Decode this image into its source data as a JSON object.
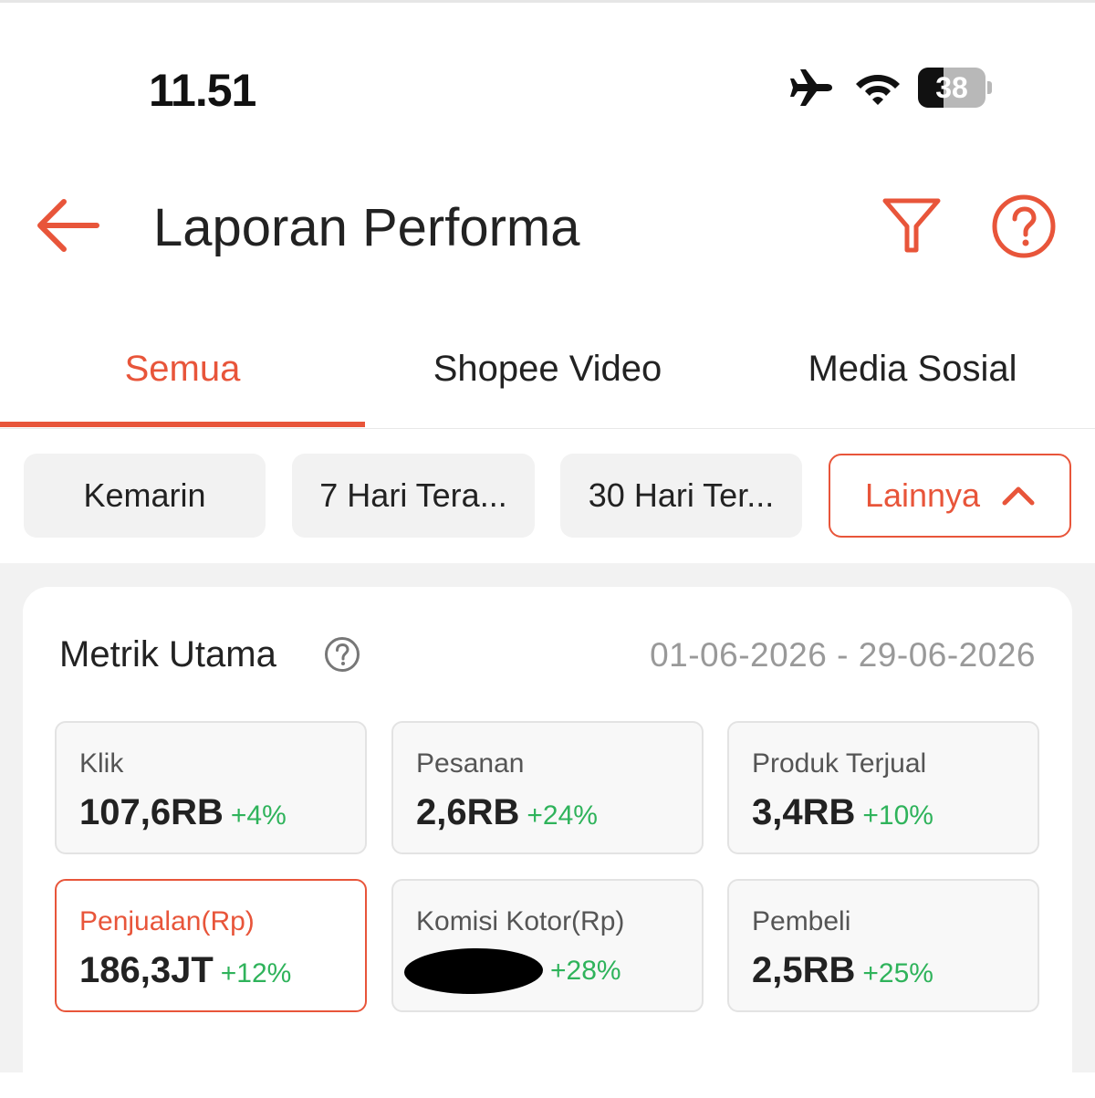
{
  "status_bar": {
    "time": "11.51",
    "battery_level": "38",
    "battery_fraction": 0.38
  },
  "header": {
    "title": "Laporan Performa"
  },
  "tabs": [
    {
      "label": "Semua",
      "active": true
    },
    {
      "label": "Shopee Video",
      "active": false
    },
    {
      "label": "Media Sosial",
      "active": false
    }
  ],
  "date_filters": [
    {
      "label": "Kemarin",
      "selected": false
    },
    {
      "label": "7 Hari Tera...",
      "selected": false
    },
    {
      "label": "30 Hari Ter...",
      "selected": false
    },
    {
      "label": "Lainnya",
      "selected": true
    }
  ],
  "main_metrics": {
    "title": "Metrik Utama",
    "date_range": "01-06-2026 - 29-06-2026",
    "items": [
      {
        "label": "Klik",
        "value": "107,6RB",
        "change": "+4%"
      },
      {
        "label": "Pesanan",
        "value": "2,6RB",
        "change": "+24%"
      },
      {
        "label": "Produk Terjual",
        "value": "3,4RB",
        "change": "+10%"
      },
      {
        "label": "Penjualan(Rp)",
        "value": "186,3JT",
        "change": "+12%",
        "selected": true
      },
      {
        "label": "Komisi Kotor(Rp)",
        "value": "",
        "change": "+28%",
        "redacted": true
      },
      {
        "label": "Pembeli",
        "value": "2,5RB",
        "change": "+25%"
      }
    ]
  },
  "colors": {
    "accent": "#e8553a",
    "positive": "#2fb35b",
    "muted_text": "#999999",
    "chip_bg": "#f2f2f2"
  },
  "icons": [
    "airplane-icon",
    "wifi-icon",
    "battery-icon",
    "back-arrow-icon",
    "filter-icon",
    "help-icon",
    "chevron-up-icon"
  ]
}
